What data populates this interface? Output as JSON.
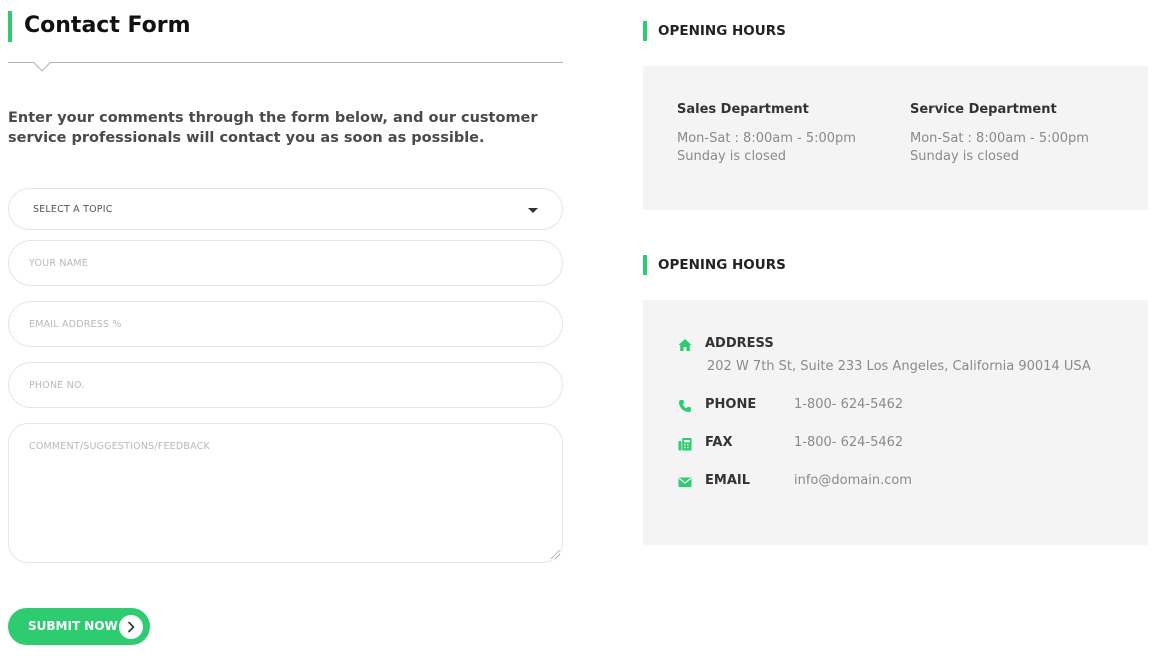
{
  "form": {
    "title": "Contact Form",
    "intro": "Enter your comments through the form below, and our customer service professionals will contact you as soon as possible.",
    "topic_select": {
      "selected": "SELECT A TOPIC"
    },
    "name_placeholder": "YOUR NAME",
    "email_placeholder": "EMAIL ADDRESS %",
    "phone_placeholder": "PHONE NO.",
    "comment_placeholder": "COMMENT/SUGGESTIONS/FEEDBACK",
    "submit_label": "SUBMIT NOW"
  },
  "hours": {
    "title": "OPENING HOURS",
    "departments": [
      {
        "name": "Sales Department",
        "weekday": "Mon-Sat : 8:00am - 5:00pm",
        "sunday": "Sunday is closed"
      },
      {
        "name": "Service Department",
        "weekday": "Mon-Sat : 8:00am - 5:00pm",
        "sunday": "Sunday is closed"
      }
    ]
  },
  "contact": {
    "title": "OPENING HOURS",
    "address": {
      "label": "ADDRESS",
      "value": "202 W 7th St, Suite 233 Los Angeles, California 90014 USA",
      "icon": "home-icon"
    },
    "phone": {
      "label": "PHONE",
      "value": "1-800- 624-5462",
      "icon": "phone-icon"
    },
    "fax": {
      "label": "FAX",
      "value": "1-800- 624-5462",
      "icon": "fax-icon"
    },
    "email": {
      "label": "EMAIL",
      "value": "info@domain.com",
      "icon": "envelope-icon"
    }
  },
  "colors": {
    "accent": "#2ecc71",
    "panel_bg": "#f4f4f4",
    "text_dark": "#333333",
    "text_muted": "#8a8a8a"
  }
}
